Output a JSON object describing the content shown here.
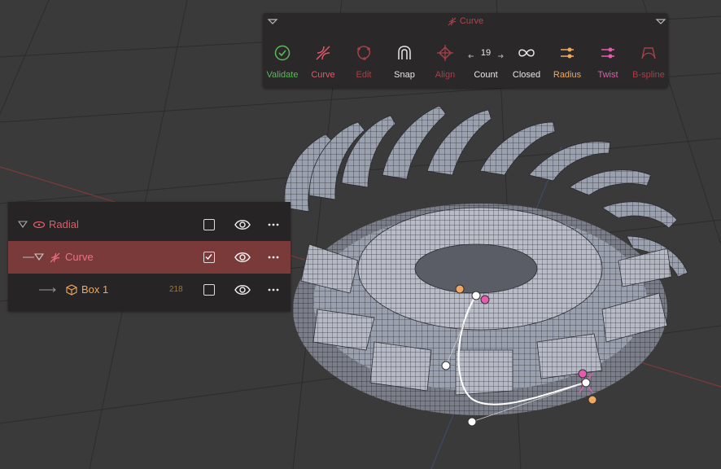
{
  "toolbar": {
    "title": "Curve",
    "tools": [
      {
        "label": "Validate",
        "icon": "check-circle-icon",
        "color": "#5cb85c"
      },
      {
        "label": "Curve",
        "icon": "curve-icon",
        "color": "#e25a6a"
      },
      {
        "label": "Edit",
        "icon": "edit-shape-icon",
        "color": "#a8404a"
      },
      {
        "label": "Snap",
        "icon": "magnet-icon",
        "color": "#e8e8e8"
      },
      {
        "label": "Align",
        "icon": "align-target-icon",
        "color": "#a8404a"
      },
      {
        "label": "Count",
        "icon": "counter-icon",
        "value": "19",
        "color": "#e8e8e8"
      },
      {
        "label": "Closed",
        "icon": "infinity-icon",
        "color": "#e8e8e8"
      },
      {
        "label": "Radius",
        "icon": "radius-sliders-icon",
        "color": "#f0a860"
      },
      {
        "label": "Twist",
        "icon": "twist-sliders-icon",
        "color": "#e85ab0"
      },
      {
        "label": "B-spline",
        "icon": "bspline-icon",
        "color": "#a8404a"
      }
    ]
  },
  "outliner": {
    "rows": [
      {
        "name": "Radial",
        "icon": "radial-icon",
        "color": "#e25a6a",
        "checked": false,
        "count": ""
      },
      {
        "name": "Curve",
        "icon": "curve-icon",
        "color": "#e25a6a",
        "checked": true,
        "count": ""
      },
      {
        "name": "Box 1",
        "icon": "cube-icon",
        "color": "#f0a860",
        "checked": false,
        "count": "218"
      }
    ]
  },
  "colors": {
    "background": "#3b3a3a",
    "selected_row": "#7a3a3a",
    "accent_red": "#e25a6a",
    "accent_orange": "#f0a860",
    "accent_pink": "#e85ab0"
  }
}
